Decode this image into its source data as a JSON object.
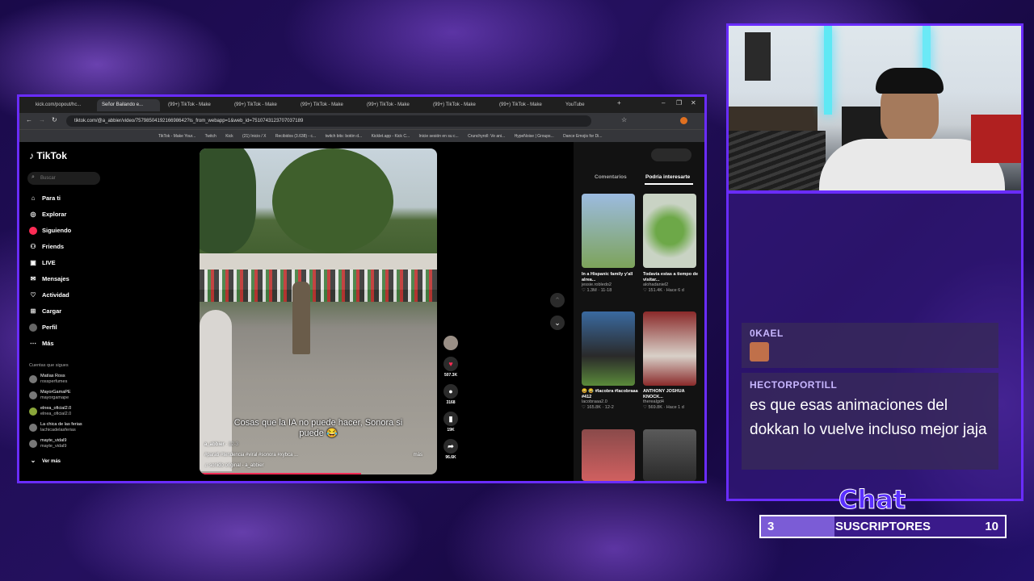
{
  "browser": {
    "tabs": [
      {
        "label": "kick.com/popout/hc..."
      },
      {
        "label": "Señor Bailando e..."
      },
      {
        "label": "(99+) TikTok - Make"
      },
      {
        "label": "(99+) TikTok - Make"
      },
      {
        "label": "(99+) TikTok - Make"
      },
      {
        "label": "(99+) TikTok - Make"
      },
      {
        "label": "(99+) TikTok - Make"
      },
      {
        "label": "(99+) TikTok - Make"
      },
      {
        "label": "YouTube"
      }
    ],
    "url": "tiktok.com/@a_abbier/video/7579850419216698642?is_from_webapp=1&web_id=7510743123707037189",
    "bookmarks": [
      "TikTok - Make Your...",
      "Twitch",
      "Kick",
      "(21) Inicio / X",
      "Recibidos (3.638) - c...",
      "twitch bits: botón d...",
      "Kicklet.app - Kick C...",
      "Inicie sesión en su c...",
      "Crunchyroll: Ve ani...",
      "HypeNoise | Groups...",
      "Dance Emojis for Di..."
    ]
  },
  "tiktok": {
    "logo": "TikTok",
    "search_placeholder": "Buscar",
    "nav": [
      {
        "label": "Para ti",
        "icon": "home-icon"
      },
      {
        "label": "Explorar",
        "icon": "compass-icon"
      },
      {
        "label": "Siguiendo",
        "icon": "following-icon"
      },
      {
        "label": "Friends",
        "icon": "friends-icon"
      },
      {
        "label": "LIVE",
        "icon": "live-icon"
      },
      {
        "label": "Mensajes",
        "icon": "message-icon"
      },
      {
        "label": "Actividad",
        "icon": "activity-icon"
      },
      {
        "label": "Cargar",
        "icon": "upload-icon"
      },
      {
        "label": "Perfil",
        "icon": "profile-icon"
      },
      {
        "label": "Más",
        "icon": "more-icon"
      }
    ],
    "following_header": "Cuentas que sigues",
    "accounts": [
      {
        "name": "Matías Ross",
        "user": "rossperfumes"
      },
      {
        "name": "MayorGamaPE",
        "user": "mayorgamape"
      },
      {
        "name": "elnea_oficial2.0",
        "user": "elnea_oficial2.0"
      },
      {
        "name": "La chica de las ferias",
        "user": "lachicadelasferias"
      },
      {
        "name": "mayte_vidal9",
        "user": "mayte_vidal9"
      }
    ],
    "see_more": "Ver más",
    "video": {
      "caption": "Cosas que la IA no puede hacer, Sonora si puede 😂",
      "author": "a_abbier",
      "date": "12-3",
      "hashtags": "#parati #tendencia #viral #sonora #xybca ...",
      "more": "más",
      "sound": "sonido original - a_abbier",
      "progress": 0.68
    },
    "actions": {
      "likes": "507.3K",
      "comments": "3168",
      "saves": "19K",
      "shares": "96.6K"
    },
    "panel": {
      "tab_comments": "Comentarios",
      "tab_interesting": "Podría interesarte",
      "videos": [
        {
          "title": "In a Hispanic family y'all alrea...",
          "author": "jessie.robledo2",
          "views": "1.3M",
          "date": "11-18",
          "thumb": "#7da35a"
        },
        {
          "title": "Todavía estas a tiempo de visitar...",
          "author": "alohadaniel2",
          "views": "151.4K",
          "date": "Hace 6 d",
          "thumb": "#6da848"
        },
        {
          "title": "😀 😂 #lacobra #lacobraaa #412",
          "author": "lacobraaa2.0",
          "views": "165.8K",
          "date": "12-2",
          "thumb": "#3a6aa0"
        },
        {
          "title": "ANTHONY JOSHUA KNOCK...",
          "author": "therealgd4",
          "views": "569.8K",
          "date": "Hace 1 d",
          "thumb": "#8a2a2a"
        },
        {
          "title": "",
          "author": "",
          "views": "",
          "date": "",
          "thumb": "#a84a4a"
        },
        {
          "title": "",
          "author": "",
          "views": "",
          "date": "",
          "thumb": "#3a3a3a"
        }
      ]
    }
  },
  "chat": {
    "messages": [
      {
        "user": "0KAEL",
        "text": ""
      },
      {
        "user": "HECTORPORTILL",
        "text": "es que esas animaciones del dokkan lo vuelve incluso mejor jaja"
      }
    ],
    "title": "Chat",
    "subs_current": "3",
    "subs_label": "SUSCRIPTORES",
    "subs_goal": "10",
    "subs_progress": 0.3
  }
}
